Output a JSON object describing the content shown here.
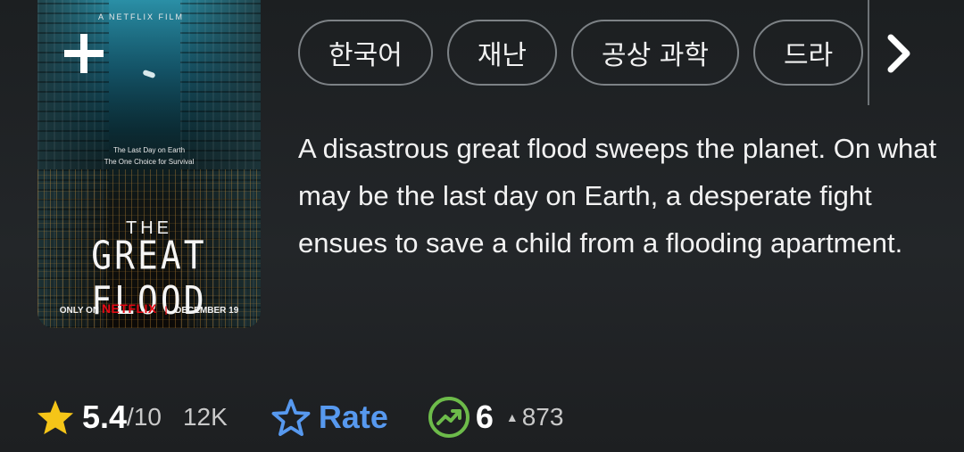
{
  "poster": {
    "film_tag": "A NETFLIX FILM",
    "tagline_1": "The Last Day on Earth",
    "tagline_2": "The One Choice for Survival",
    "title_the": "THE",
    "title_main": "GREAT FLOOD",
    "footer_only": "ONLY ON",
    "footer_brand": "NETFLIX",
    "footer_sep": "|",
    "footer_date": "DECEMBER 19",
    "add_icon": "plus-icon"
  },
  "genres": [
    "한국어",
    "재난",
    "공상 과학",
    "드라"
  ],
  "genre_next_icon": "chevron-right-icon",
  "description": "A disastrous great flood sweeps the planet. On what may be the last day on Earth, a desperate fight ensues to save a child from a flooding apartment.",
  "stats": {
    "rating_value": "5.4",
    "rating_max": "/10",
    "vote_count": "12K",
    "rate_label": "Rate",
    "popularity_rank": "6",
    "popularity_change": "873"
  },
  "colors": {
    "star": "#f5c518",
    "rate_accent": "#5799ef",
    "popularity": "#6dbb4a",
    "background": "#1f2224"
  }
}
